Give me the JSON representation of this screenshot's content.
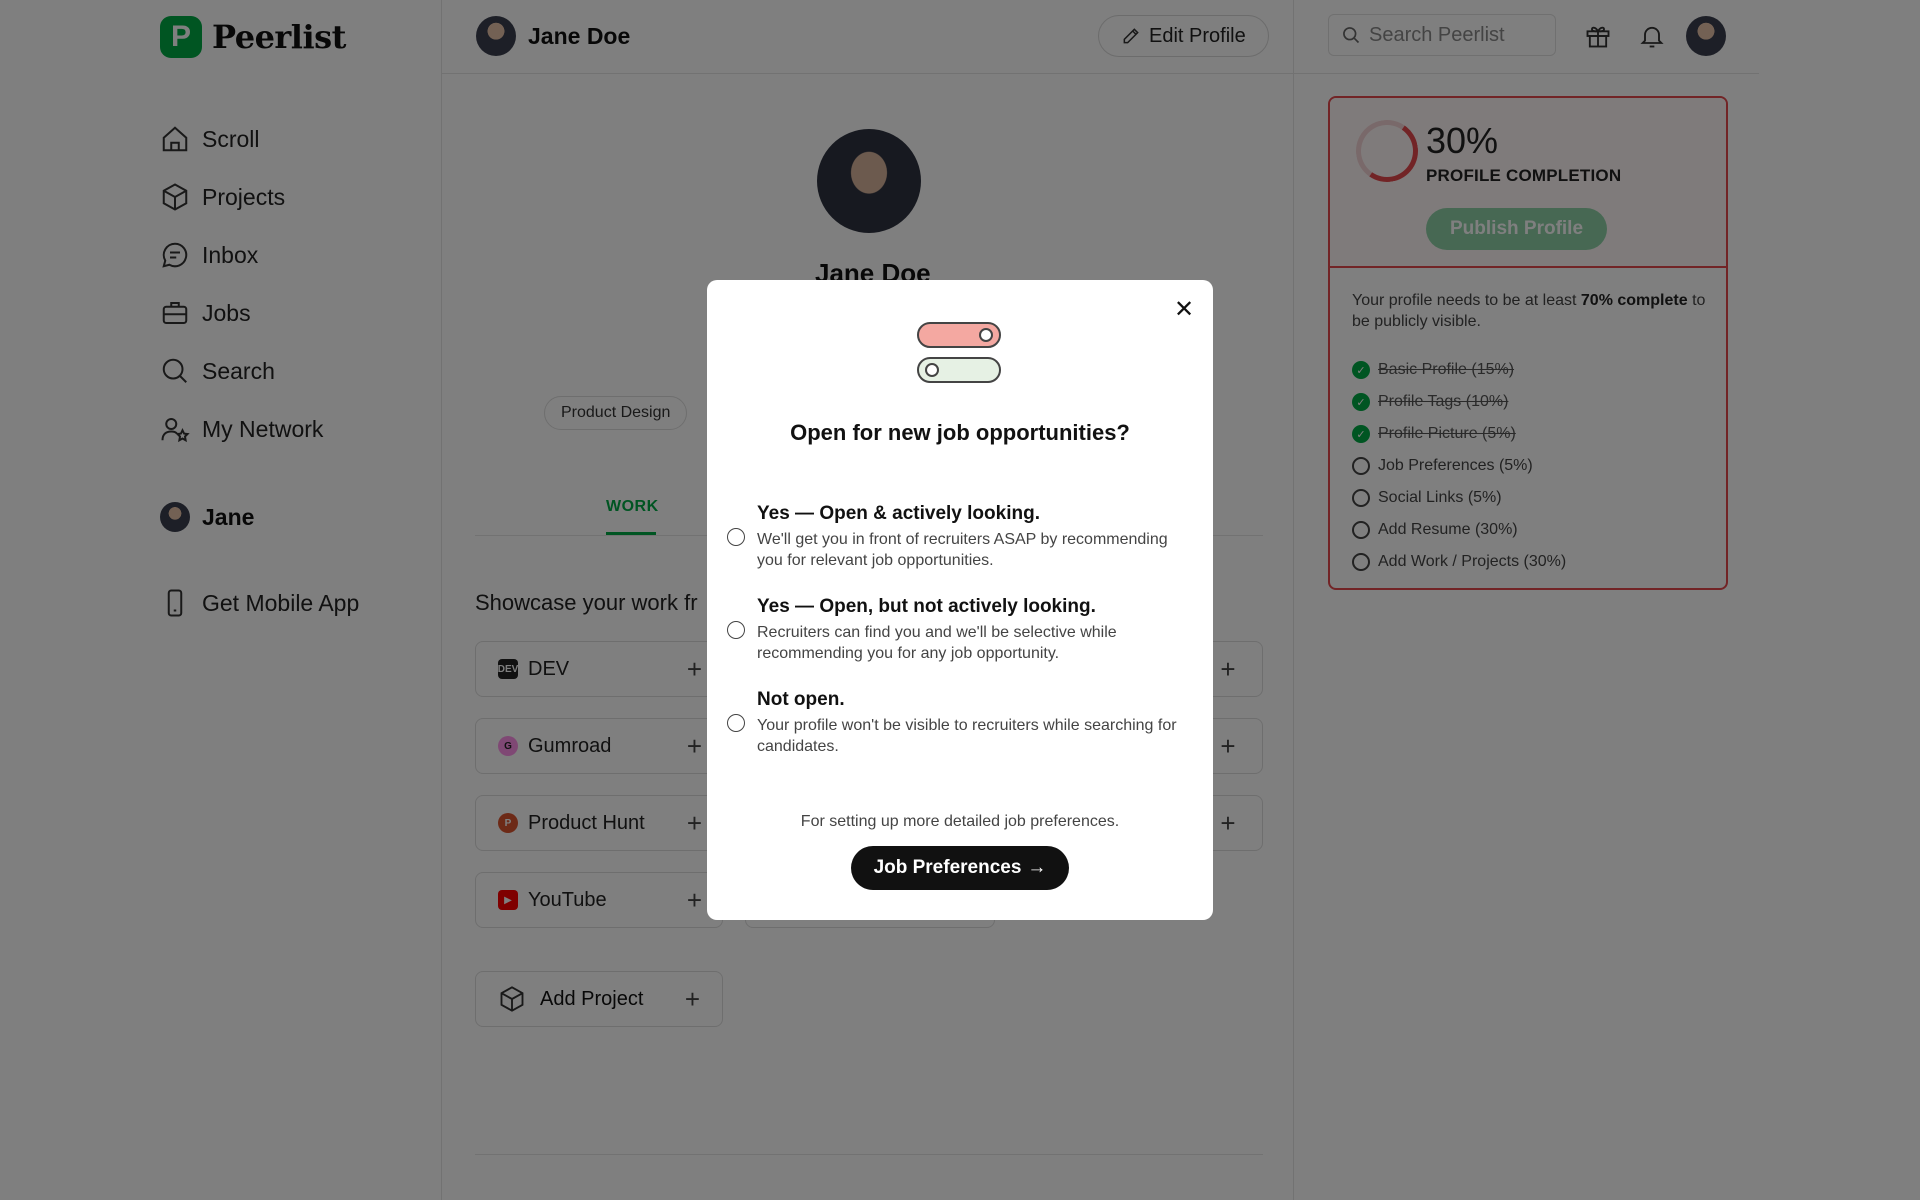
{
  "brand": {
    "name": "Peerlist",
    "mark": "P"
  },
  "sidebar": {
    "items": [
      {
        "label": "Scroll",
        "icon": "home-icon"
      },
      {
        "label": "Projects",
        "icon": "cube-icon"
      },
      {
        "label": "Inbox",
        "icon": "chat-icon"
      },
      {
        "label": "Jobs",
        "icon": "briefcase-icon"
      },
      {
        "label": "Search",
        "icon": "search-icon"
      },
      {
        "label": "My Network",
        "icon": "network-icon"
      }
    ],
    "user_label": "Jane",
    "mobile_label": "Get Mobile App"
  },
  "header": {
    "name": "Jane Doe",
    "edit_label": "Edit Profile",
    "search_placeholder": "Search Peerlist"
  },
  "profile": {
    "name": "Jane Doe",
    "tag": "Product Design",
    "tab_work": "WORK",
    "showcase_heading": "Showcase your work fr",
    "integrations": [
      "DEV",
      "Gumroad",
      "Product Hunt",
      "YouTube"
    ],
    "add_project_label": "Add Project"
  },
  "completion": {
    "percent_text": "30%",
    "percent": 30,
    "label": "PROFILE COMPLETION",
    "publish_label": "Publish Profile",
    "msg_prefix": "Your profile needs to be at least ",
    "msg_bold": "70% complete",
    "msg_suffix": " to be publicly visible.",
    "items": [
      {
        "label": "Basic Profile (15%)",
        "done": true
      },
      {
        "label": "Profile Tags (10%)",
        "done": true
      },
      {
        "label": "Profile Picture (5%)",
        "done": true
      },
      {
        "label": "Job Preferences (5%)",
        "done": false
      },
      {
        "label": "Social Links (5%)",
        "done": false
      },
      {
        "label": "Add Resume (30%)",
        "done": false
      },
      {
        "label": "Add Work / Projects (30%)",
        "done": false
      }
    ]
  },
  "modal": {
    "title": "Open for new job opportunities?",
    "options": [
      {
        "title": "Yes — Open & actively looking.",
        "desc": "We'll get you in front of recruiters ASAP by recommending you for relevant job opportunities."
      },
      {
        "title": "Yes — Open, but not actively looking.",
        "desc": "Recruiters can find you and we'll be selective while recommending you for any job opportunity."
      },
      {
        "title": "Not open.",
        "desc": "Your profile won't be visible to recruiters while searching for candidates."
      }
    ],
    "footnote": "For setting up more detailed job preferences.",
    "cta_label": "Job Preferences",
    "cta_arrow": "→",
    "close_glyph": "✕"
  },
  "colors": {
    "brand_green": "#00aa45",
    "alert_red": "#e5484d"
  }
}
